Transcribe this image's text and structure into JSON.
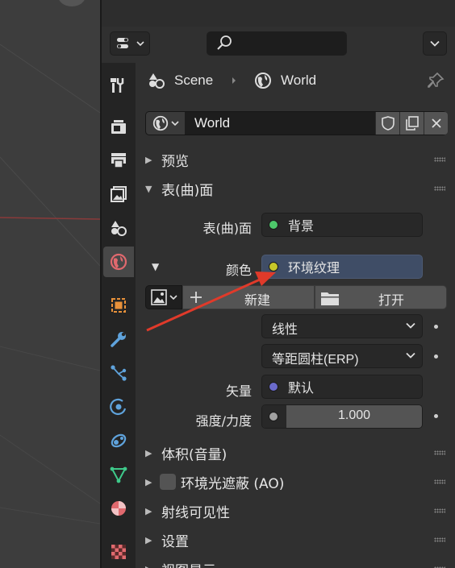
{
  "header": {
    "search_placeholder": "",
    "editor_type_icon": "editor-type-icon",
    "search_icon": "search-icon"
  },
  "tabs": [
    {
      "id": "tool",
      "icon": "tool-icon"
    },
    {
      "id": "render",
      "icon": "render-icon"
    },
    {
      "id": "output",
      "icon": "output-icon"
    },
    {
      "id": "view_layer",
      "icon": "view-layer-icon"
    },
    {
      "id": "scene",
      "icon": "scene-icon"
    },
    {
      "id": "world",
      "icon": "world-icon",
      "active": true
    },
    {
      "id": "object",
      "icon": "object-icon"
    },
    {
      "id": "modifiers",
      "icon": "wrench-icon"
    },
    {
      "id": "particles",
      "icon": "particles-icon"
    },
    {
      "id": "physics",
      "icon": "physics-icon"
    },
    {
      "id": "constraints",
      "icon": "constraints-icon"
    },
    {
      "id": "data",
      "icon": "mesh-data-icon"
    },
    {
      "id": "material",
      "icon": "material-icon"
    },
    {
      "id": "texture",
      "icon": "texture-icon"
    }
  ],
  "breadcrumb": {
    "scene": "Scene",
    "world": "World"
  },
  "datablock": {
    "name": "World"
  },
  "sections": {
    "preview": "预览",
    "surface": "表(曲)面",
    "volume": "体积(音量)",
    "ao": "环境光遮蔽 (AO)",
    "ray_visibility": "射线可见性",
    "settings": "设置",
    "viewport_display": "视图显示"
  },
  "surface": {
    "label": "表(曲)面",
    "value": "背景",
    "socket_color": "#4dc76a"
  },
  "color": {
    "label": "颜色",
    "value": "环境纹理",
    "socket_color": "#c7c729"
  },
  "image": {
    "new_label": "新建",
    "open_label": "打开"
  },
  "interpolation": {
    "value": "线性"
  },
  "projection": {
    "value": "等距圆柱(ERP)"
  },
  "vector": {
    "label": "矢量",
    "value": "默认",
    "socket_color": "#6a6acb"
  },
  "strength": {
    "label": "强度/力度",
    "value": "1.000",
    "socket_color": "#a1a1a1"
  },
  "colors": {
    "accent_blue": "#3f4d66",
    "annotation_arrow": "#e03a2a"
  }
}
